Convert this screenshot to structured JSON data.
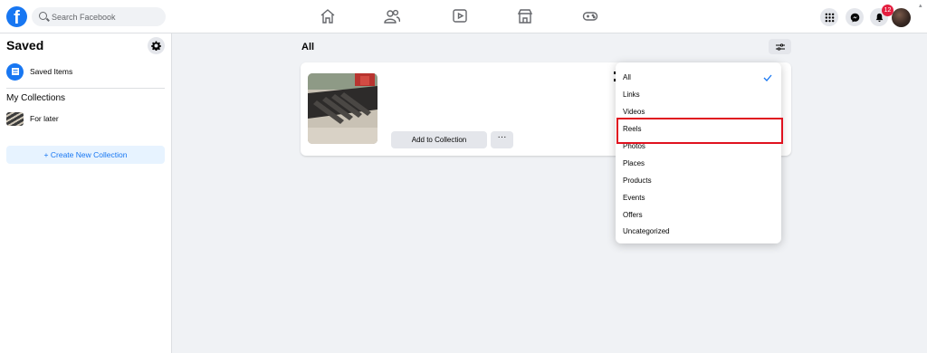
{
  "search": {
    "placeholder": "Search Facebook"
  },
  "nav": {
    "icons": [
      "home-icon",
      "friends-icon",
      "watch-icon",
      "marketplace-icon",
      "gaming-icon"
    ],
    "right_icons": [
      "menu-grid-icon",
      "messenger-icon",
      "bell-icon"
    ],
    "notification_count": "12"
  },
  "sidebar": {
    "title": "Saved",
    "saved_items_label": "Saved Items",
    "collections_title": "My Collections",
    "collections": [
      {
        "label": "For later"
      }
    ],
    "create_label": "+ Create New Collection"
  },
  "main": {
    "title": "All",
    "card": {
      "add_label": "Add to Collection",
      "more_label": "···"
    }
  },
  "dropdown": {
    "items": [
      {
        "label": "All",
        "selected": true
      },
      {
        "label": "Links"
      },
      {
        "label": "Videos"
      },
      {
        "label": "Reels",
        "highlighted": true
      },
      {
        "label": "Photos"
      },
      {
        "label": "Places"
      },
      {
        "label": "Products"
      },
      {
        "label": "Events"
      },
      {
        "label": "Offers"
      },
      {
        "label": "Uncategorized"
      }
    ]
  },
  "colors": {
    "brand": "#1877f2",
    "highlight": "#e0121f",
    "badge": "#e41e3f"
  }
}
